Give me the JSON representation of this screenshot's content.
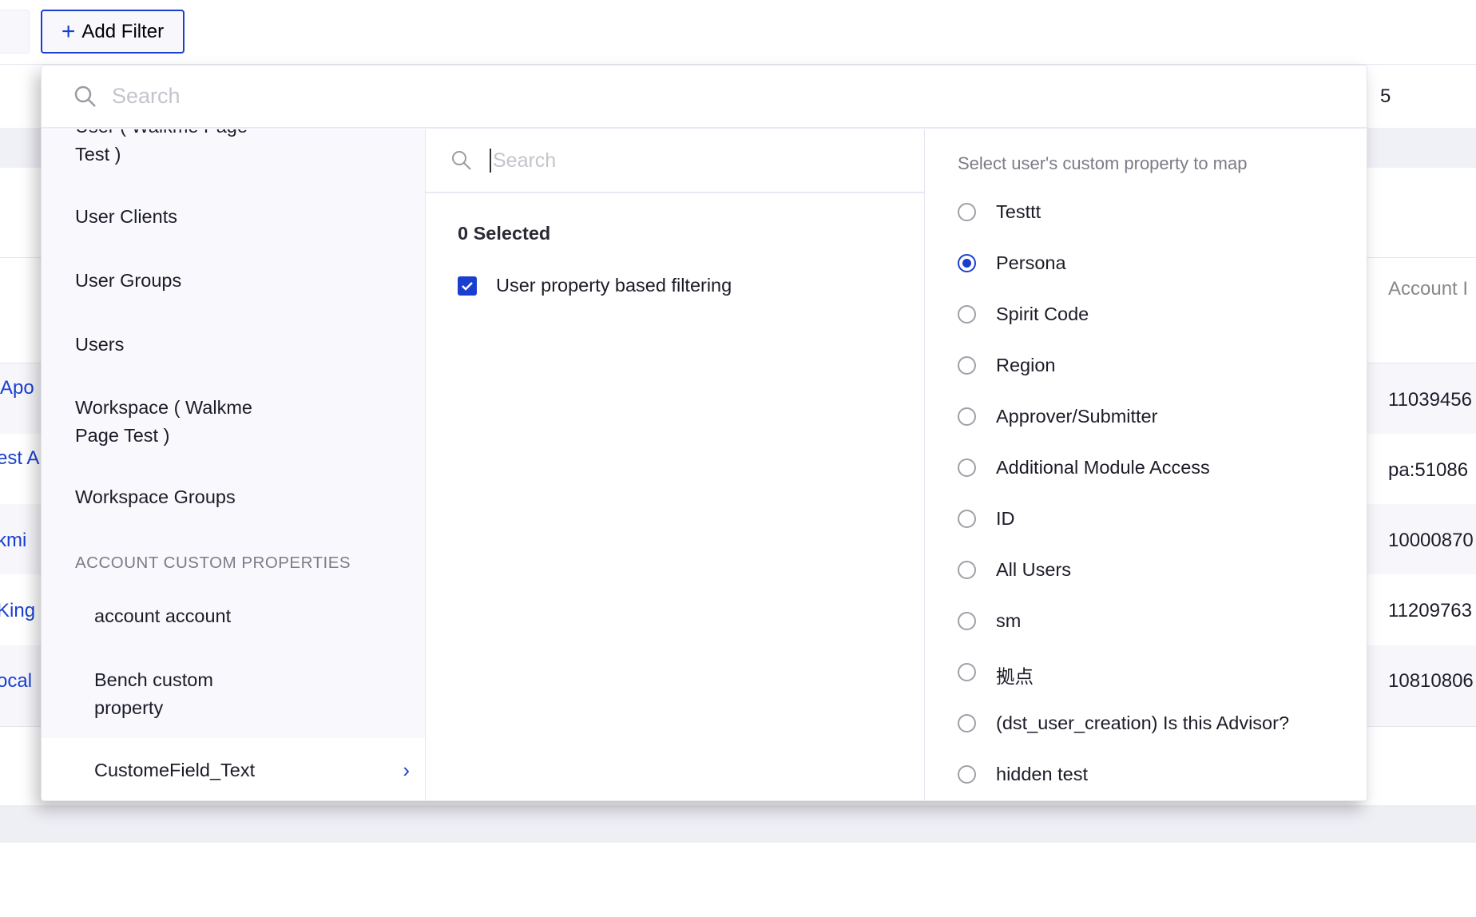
{
  "toolbar": {
    "add_filter_label": "Add Filter",
    "add_filter_icon": "plus-icon"
  },
  "background": {
    "pagination_text": "5",
    "column_header": "Account I",
    "left_cells": [
      "Apo",
      "est A",
      "kmi",
      "King",
      "ocal"
    ],
    "right_cells": [
      "11039456",
      "pa:51086",
      "10000870",
      "11209763",
      "10810806"
    ]
  },
  "dropdown": {
    "search_placeholder": "Search",
    "left": {
      "items": [
        "User ( Walkme Page Test )",
        "User Clients",
        "User Groups",
        "Users",
        "Workspace ( Walkme Page Test )",
        "Workspace Groups"
      ],
      "section_title": "ACCOUNT CUSTOM PROPERTIES",
      "sub_items": [
        "account account",
        "Bench custom property",
        "CustomeField_Text"
      ]
    },
    "middle": {
      "search_placeholder": "Search",
      "selected_count": "0 Selected",
      "checkbox_label": "User property based filtering",
      "checkbox_checked": true
    },
    "right": {
      "header": "Select user's custom property to map",
      "options": [
        "Testtt",
        "Persona",
        "Spirit Code",
        "Region",
        "Approver/Submitter",
        "Additional Module Access",
        "ID",
        "All Users",
        "sm",
        "拠点",
        "(dst_user_creation) Is this Advisor?",
        "hidden test"
      ],
      "selected": "Persona"
    }
  },
  "colors": {
    "accent": "#1a3fd0"
  }
}
